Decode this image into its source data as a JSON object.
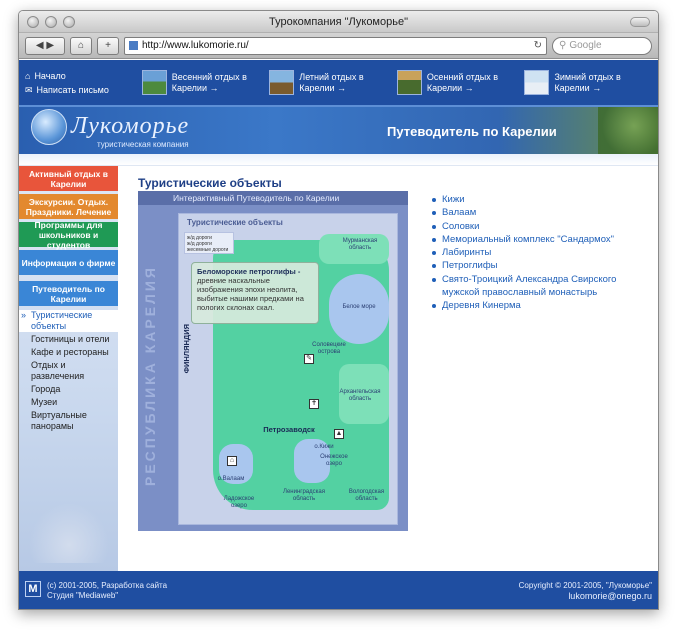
{
  "browser": {
    "title": "Турокомпания \"Лукоморье\"",
    "url": "http://www.lukomorie.ru/",
    "search_placeholder": "Google",
    "back_icon": "◀",
    "forward_icon": "▶",
    "home_icon": "⌂",
    "add_icon": "+",
    "reload_icon": "↻"
  },
  "topbar": {
    "home_label": "Начало",
    "mail_label": "Написать письмо",
    "promos": [
      {
        "label": "Весенний отдых в Карелии →"
      },
      {
        "label": "Летний отдых в Карелии →"
      },
      {
        "label": "Осенний отдых в Карелии →"
      },
      {
        "label": "Зимний отдых в Карелии →"
      }
    ]
  },
  "banner": {
    "logo": "Лукоморье",
    "logo_sub": "туристическая компания",
    "guide_title": "Путеводитель по Карелии"
  },
  "sidebar": {
    "buttons": [
      "Активный отдых в Карелии",
      "Экскурсии. Отдых. Праздники. Лечение",
      "Программы для школьников и студентов",
      "Информация о фирме",
      "Путеводитель по Карелии"
    ],
    "submenu": [
      "Туристические объекты",
      "Гостиницы и отели",
      "Кафе и рестораны",
      "Отдых и развлечения",
      "Города",
      "Музеи",
      "Виртуальные панорамы"
    ]
  },
  "content": {
    "title": "Туристические объекты",
    "map_header": "Интерактивный Путеводитель по Карелии",
    "map_vertical": "РЕСПУБЛИКА КАРЕЛИЯ",
    "map_title": "Туристические объекты",
    "legend": [
      "ж/д дороги",
      "ж/д дороги",
      "жесемные дороги"
    ],
    "tooltip_title": "Беломорские петроглифы -",
    "tooltip_text": "древние наскальные изображения эпохи неолита, выбитые нашими предками на пологих склонах скал.",
    "map_labels": {
      "murmansk": "Мурманская область",
      "white_sea": "Белое море",
      "finland": "ФИНЛЯНДИЯ",
      "islands": "Соловецкие острова",
      "arkhangelsk": "Архангельская область",
      "petrozavodsk": "Петрозаводск",
      "kizhi": "о.Кижи",
      "onega": "Онежское озеро",
      "valaam": "о.Валаам",
      "ladoga": "Ладожское озеро",
      "leningrad": "Ленинградская область",
      "vologda": "Вологодская область"
    },
    "objects": [
      "Кижи",
      "Валаам",
      "Соловки",
      "Мемориальный комплекс \"Сандармох\"",
      "Лабиринты",
      "Петроглифы",
      "Свято-Троицкий Александра Свирского мужской православный монастырь",
      "Деревня Кинерма"
    ]
  },
  "footer": {
    "logo_text": "M",
    "left_line1": "(с) 2001-2005, Разработка сайта",
    "left_line2": "Студия \"Mediaweb\"",
    "right_line1": "Copyright © 2001-2005, \"Лукоморье\"",
    "right_line2": "lukomorie@onego.ru"
  },
  "colors": {
    "brand_blue": "#1f4ea1",
    "link": "#1f5fb8"
  }
}
